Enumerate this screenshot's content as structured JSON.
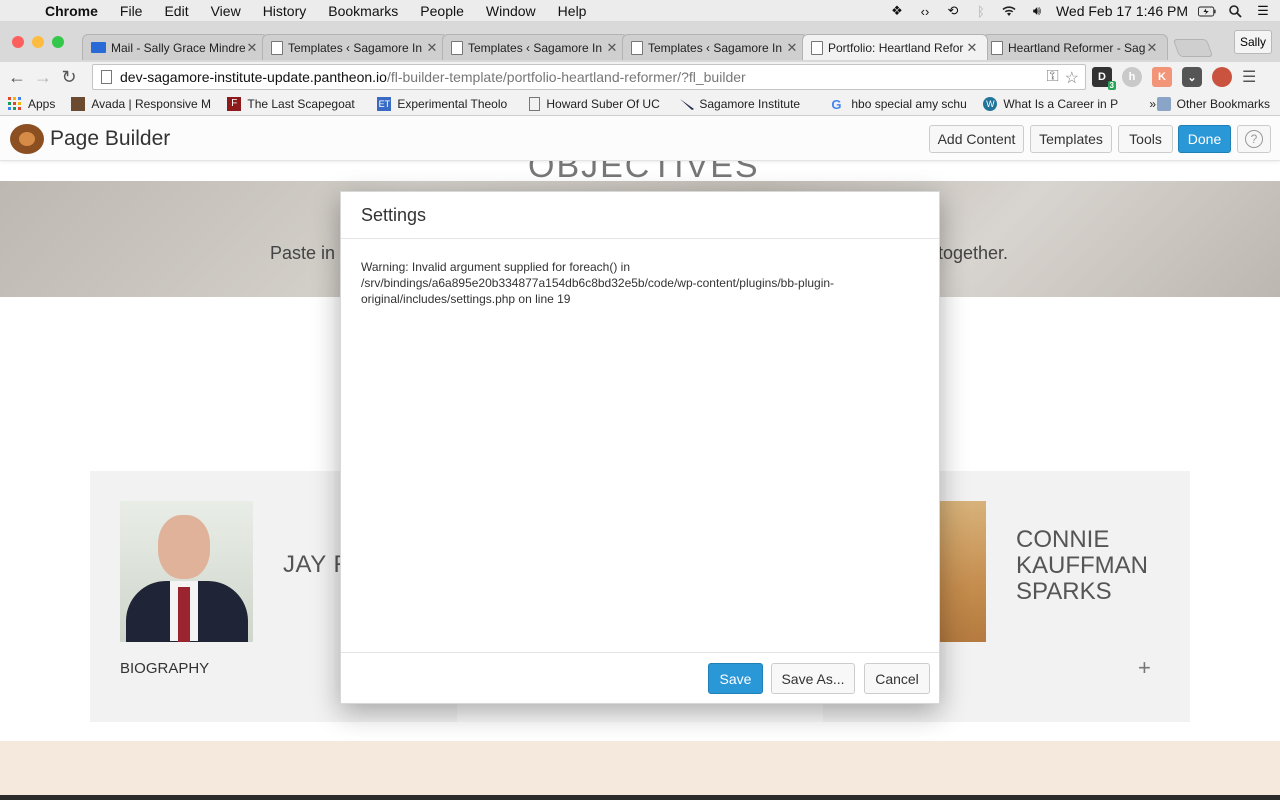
{
  "menubar": {
    "app_name": "Chrome",
    "items": [
      "File",
      "Edit",
      "View",
      "History",
      "Bookmarks",
      "People",
      "Window",
      "Help"
    ],
    "clock": "Wed Feb 17  1:46 PM"
  },
  "tabs": [
    {
      "title": "Mail - Sally Grace Mindre"
    },
    {
      "title": "Templates ‹ Sagamore In"
    },
    {
      "title": "Templates ‹ Sagamore In"
    },
    {
      "title": "Templates ‹ Sagamore In"
    },
    {
      "title": "Portfolio: Heartland Refor"
    },
    {
      "title": "Heartland Reformer - Sag"
    }
  ],
  "profile": {
    "name": "Sally"
  },
  "address_bar": {
    "host": "dev-sagamore-institute-update.pantheon.io",
    "path": "/fl-builder-template/portfolio-heartland-reformer/?fl_builder"
  },
  "extensions": {
    "badge": "3"
  },
  "bookmarks": {
    "items": [
      {
        "label": "Apps"
      },
      {
        "label": "Avada | Responsive M"
      },
      {
        "label": "The Last Scapegoat"
      },
      {
        "label": "Experimental Theolo"
      },
      {
        "label": "Howard Suber Of UC"
      },
      {
        "label": "Sagamore Institute"
      },
      {
        "label": "hbo special amy schu"
      },
      {
        "label": "What Is a Career in P"
      }
    ],
    "overflow": "»",
    "other": "Other Bookmarks"
  },
  "page_builder": {
    "title": "Page Builder",
    "buttons": {
      "add_content": "Add Content",
      "templates": "Templates",
      "tools": "Tools",
      "done": "Done",
      "help": "?"
    }
  },
  "page": {
    "heading_fragment": "OBJECTIVES",
    "banner_left": "Paste in a",
    "banner_right": "together.",
    "people": [
      {
        "name": "JAY R",
        "link": "BIOGRAPHY"
      },
      {
        "name_lines": [
          "CONNIE",
          "KAUFFMAN",
          "SPARKS"
        ],
        "toggle": "+"
      }
    ]
  },
  "modal": {
    "title": "Settings",
    "warning_lines": [
      "Warning: Invalid argument supplied for foreach() in",
      "/srv/bindings/a6a895e20b334877a154db6c8bd32e5b/code/wp-content/plugins/bb-plugin-",
      "original/includes/settings.php on line 19"
    ],
    "buttons": {
      "save": "Save",
      "save_as": "Save As...",
      "cancel": "Cancel"
    }
  },
  "colors": {
    "accent": "#2a97d6",
    "footer_band": "#f4e9dc"
  }
}
